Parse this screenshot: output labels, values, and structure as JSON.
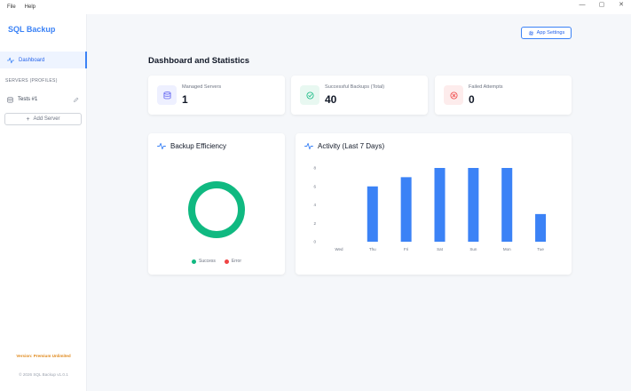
{
  "menubar": {
    "items": [
      "File",
      "Help"
    ]
  },
  "window_controls": {
    "minimize": "—",
    "maximize": "▢",
    "close": "✕"
  },
  "sidebar": {
    "brand": "SQL Backup",
    "nav": [
      {
        "label": "Dashboard",
        "icon": "activity-icon",
        "active": true
      }
    ],
    "section_label": "SERVERS (PROFILES)",
    "servers": [
      {
        "label": "Tests #1",
        "icon": "database-icon"
      }
    ],
    "add_server_label": "Add Server",
    "version_status": "Version: Premium Unlimited",
    "copyright": "© 2026 SQL Backup v1.0.1"
  },
  "header": {
    "title": "Dashboard and Statistics",
    "app_settings_label": "App Settings"
  },
  "stats": [
    {
      "label": "Managed Servers",
      "value": "1",
      "icon": "database-icon",
      "color": "#6366f1",
      "bg": "#eef0ff"
    },
    {
      "label": "Successful Backups (Total)",
      "value": "40",
      "icon": "check-circle-icon",
      "color": "#10b981",
      "bg": "#e8f8f1"
    },
    {
      "label": "Failed Attempts",
      "value": "0",
      "icon": "x-circle-icon",
      "color": "#ef4444",
      "bg": "#fdecec"
    }
  ],
  "efficiency": {
    "title": "Backup Efficiency",
    "success_value": 40,
    "error_value": 0,
    "legend": [
      {
        "label": "Success",
        "color": "#10b981"
      },
      {
        "label": "Error",
        "color": "#ef4444"
      }
    ]
  },
  "activity": {
    "title": "Activity (Last 7 Days)"
  },
  "chart_data": {
    "type": "bar",
    "title": "Activity (Last 7 Days)",
    "categories": [
      "Wed",
      "Thu",
      "Fri",
      "Sat",
      "Sun",
      "Mon",
      "Tue"
    ],
    "values": [
      0,
      6,
      7,
      8,
      8,
      8,
      3
    ],
    "ylim": [
      0,
      8
    ],
    "yticks": [
      0,
      2,
      4,
      6,
      8
    ],
    "color": "#3b82f6",
    "grid": false,
    "xlabel": "",
    "ylabel": ""
  },
  "colors": {
    "accent": "#3b82f6",
    "success": "#10b981",
    "error": "#ef4444",
    "warning": "#e08a1e"
  }
}
